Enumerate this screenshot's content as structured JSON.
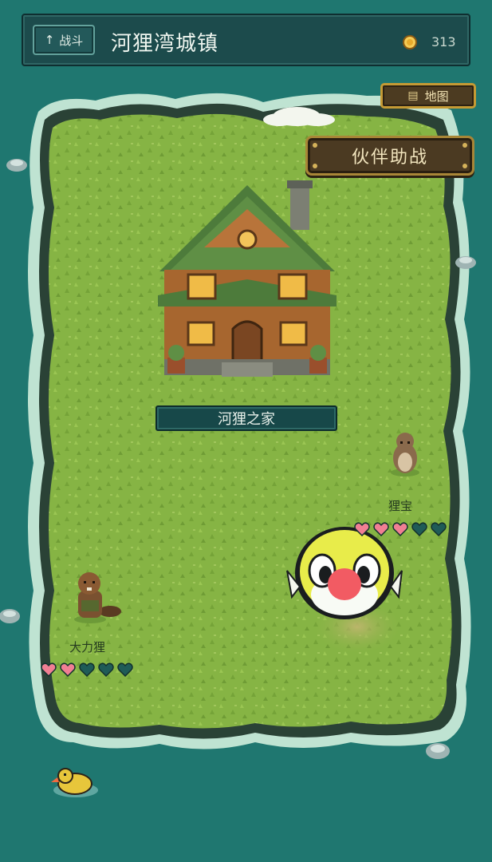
{
  "header": {
    "back_label": "战斗",
    "back_arrow": "↑",
    "title": "河狸湾城镇",
    "coins": "313"
  },
  "buttons": {
    "map_label": "地图",
    "partner_label": "伙伴助战"
  },
  "house": {
    "label": "河狸之家"
  },
  "npcs": [
    {
      "name": "狸宝",
      "hearts_filled": 3,
      "hearts_total": 5
    },
    {
      "name": "大力狸",
      "hearts_filled": 2,
      "hearts_total": 5
    }
  ],
  "colors": {
    "water": "#1f7770",
    "grass": "#86b444",
    "heart_filled": "#f07f93",
    "heart_empty": "#1f5b57",
    "button_gold": "#c59a34"
  }
}
